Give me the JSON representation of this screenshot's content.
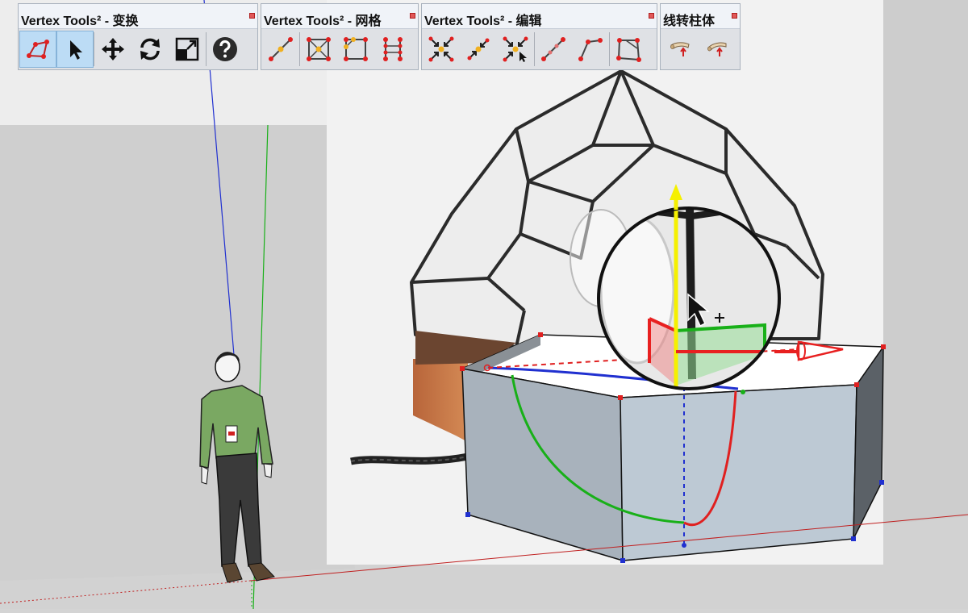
{
  "toolbars": [
    {
      "title": "Vertex Tools² - 变换",
      "buttons": [
        "vertex-select-tool",
        "arrow-select-tool",
        "move-tool",
        "rotate-tool",
        "scale-tool",
        "help-tool"
      ]
    },
    {
      "title": "Vertex Tools² - 网格",
      "buttons": [
        "line-midpoint-tool",
        "quad-center-tool",
        "quad-grid-tool",
        "edge-divide-tool"
      ]
    },
    {
      "title": "Vertex Tools² - 编辑",
      "buttons": [
        "merge-vertices-tool",
        "merge-to-center-tool",
        "merge-to-target-tool",
        "insert-vertex-tool",
        "bend-edge-tool",
        "face-outline-tool"
      ]
    },
    {
      "title": "线转柱体",
      "buttons": [
        "line-to-cylinder-tool",
        "line-to-tube-tool"
      ]
    }
  ],
  "colors": {
    "toolbar_bg": "#dfe1e5",
    "active_button": "#bcdcf5",
    "axis_red": "#e82020",
    "axis_green": "#18b018",
    "axis_blue": "#2030d0",
    "axis_yellow": "#f5f000",
    "box_front": "#bcc8d3",
    "box_side": "#5a6066"
  }
}
